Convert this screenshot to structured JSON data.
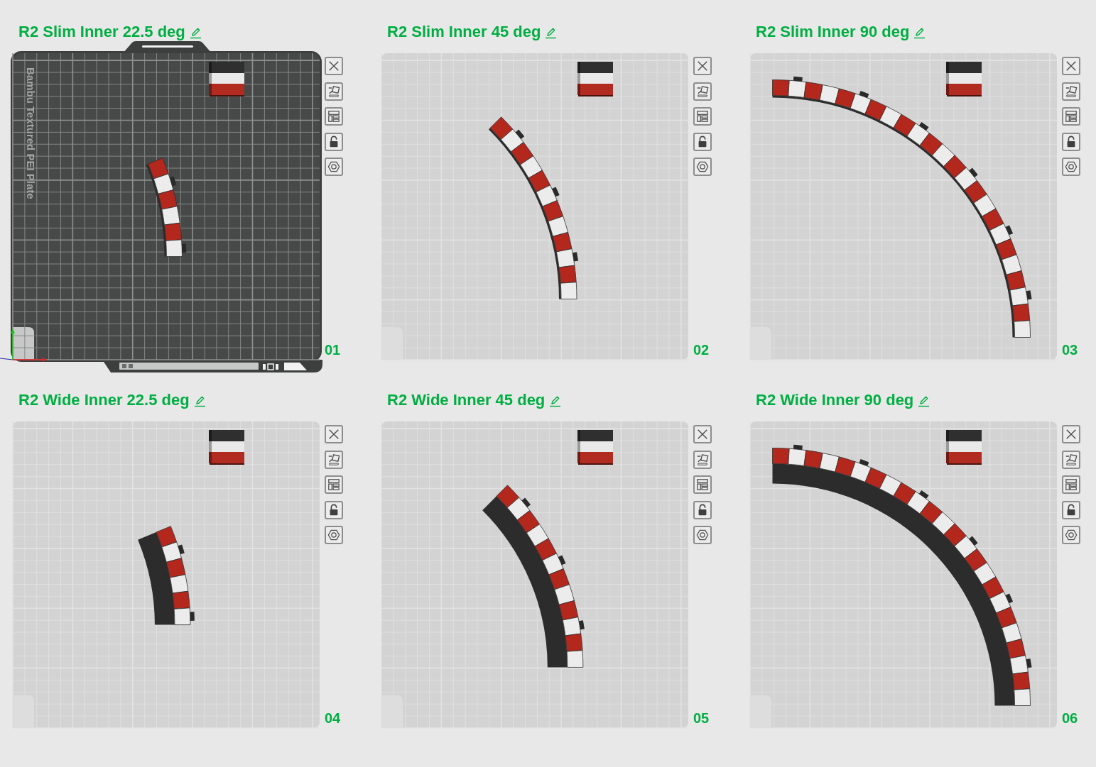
{
  "plates": [
    {
      "title": "R2 Slim Inner 22.5 deg",
      "selected": true,
      "bed_label": "Bambu Textured PEI Plate",
      "model": {
        "kind": "slim"
      },
      "locked": false,
      "number": "01"
    },
    {
      "title": "R2 Slim Inner 45 deg",
      "selected": false,
      "model": {
        "kind": "slim"
      },
      "locked": false,
      "number": "02"
    },
    {
      "title": "R2 Slim Inner 90 deg",
      "selected": false,
      "model": {
        "kind": "slim"
      },
      "locked": false,
      "number": "03"
    },
    {
      "title": "R2 Wide Inner 22.5 deg",
      "selected": false,
      "model": {
        "kind": "wide"
      },
      "locked": false,
      "number": "04"
    },
    {
      "title": "R2 Wide Inner 45 deg",
      "selected": false,
      "model": {
        "kind": "wide"
      },
      "locked": false,
      "number": "05"
    },
    {
      "title": "R2 Wide Inner 90 deg",
      "selected": false,
      "model": {
        "kind": "wide"
      },
      "locked": false,
      "number": "06"
    }
  ]
}
